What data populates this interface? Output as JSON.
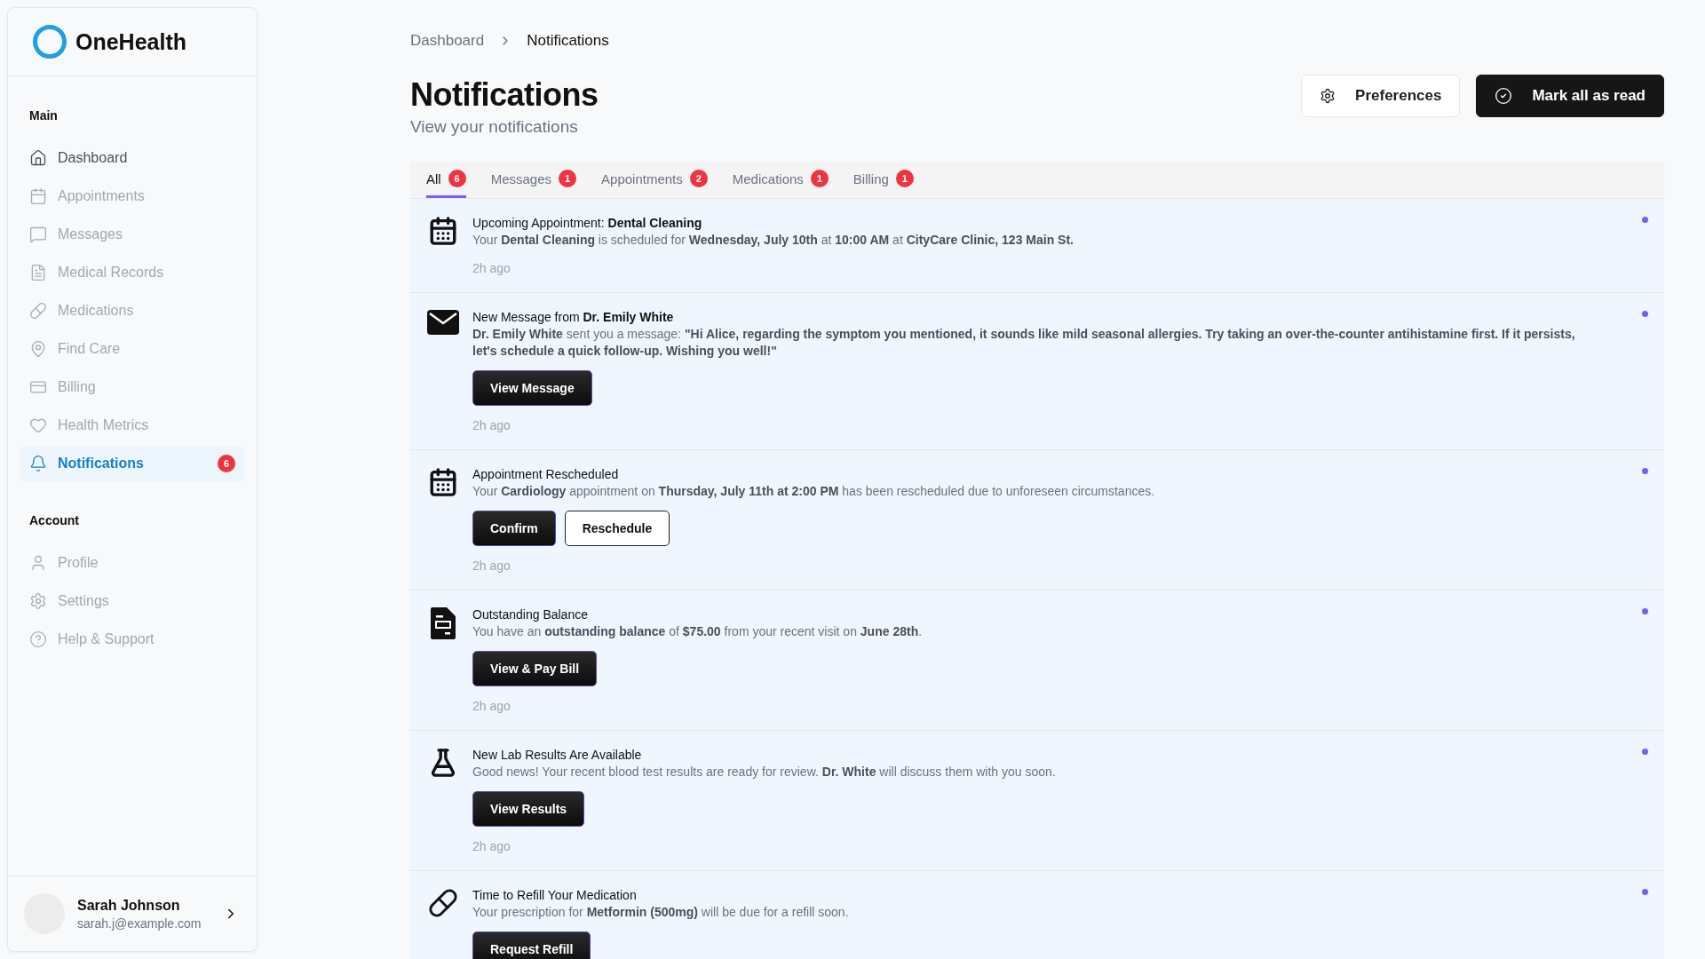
{
  "brand": {
    "name": "OneHealth"
  },
  "sidebar": {
    "sections": [
      {
        "title": "Main",
        "items": [
          {
            "label": "Dashboard",
            "kind": "home",
            "selected": false,
            "disabled": false
          },
          {
            "label": "Appointments",
            "kind": "calendar",
            "selected": false,
            "disabled": true
          },
          {
            "label": "Messages",
            "kind": "message",
            "selected": false,
            "disabled": true
          },
          {
            "label": "Medical Records",
            "kind": "file",
            "selected": false,
            "disabled": true
          },
          {
            "label": "Medications",
            "kind": "pill",
            "selected": false,
            "disabled": true
          },
          {
            "label": "Find Care",
            "kind": "pin",
            "selected": false,
            "disabled": true
          },
          {
            "label": "Billing",
            "kind": "card",
            "selected": false,
            "disabled": true
          },
          {
            "label": "Health Metrics",
            "kind": "heart",
            "selected": false,
            "disabled": true
          },
          {
            "label": "Notifications",
            "kind": "bell",
            "selected": true,
            "disabled": false,
            "badge": "6"
          }
        ]
      },
      {
        "title": "Account",
        "items": [
          {
            "label": "Profile",
            "kind": "user",
            "selected": false,
            "disabled": true
          },
          {
            "label": "Settings",
            "kind": "gear",
            "selected": false,
            "disabled": true
          },
          {
            "label": "Help & Support",
            "kind": "help",
            "selected": false,
            "disabled": true
          }
        ]
      }
    ],
    "user": {
      "name": "Sarah Johnson",
      "email": "sarah.j@example.com"
    }
  },
  "breadcrumb": [
    "Dashboard",
    "Notifications"
  ],
  "header": {
    "title": "Notifications",
    "subtitle": "View your notifications",
    "buttons": [
      {
        "label": "Preferences",
        "kind": "secondary"
      },
      {
        "label": "Mark all as read",
        "kind": "primary"
      }
    ]
  },
  "tabs": [
    {
      "label": "All",
      "count": "6",
      "selected": true
    },
    {
      "label": "Messages",
      "count": "1",
      "selected": false
    },
    {
      "label": "Appointments",
      "count": "2",
      "selected": false
    },
    {
      "label": "Medications",
      "count": "1",
      "selected": false
    },
    {
      "label": "Billing",
      "count": "1",
      "selected": false
    }
  ],
  "notifications": [
    {
      "kind": "appointment",
      "title": "Upcoming Appointment: **Dental Cleaning**",
      "body": "Your **Dental Cleaning** is scheduled for **Wednesday, July 10th** at **10:00 AM** at **CityCare Clinic, 123 Main St.**",
      "time": "2h ago",
      "unread": true
    },
    {
      "kind": "message",
      "title": "New Message from **Dr. Emily White**",
      "body": "**Dr. Emily White** sent you a message: **\"Hi Alice, regarding the symptom you mentioned, it sounds like mild seasonal allergies. Try taking an over-the-counter antihistamine first. If it persists, let's schedule a quick follow-up. Wishing you well!\"**",
      "actions": [
        {
          "label": "View Message",
          "kind": "primary"
        }
      ],
      "time": "2h ago",
      "unread": true
    },
    {
      "kind": "appointment",
      "title": "Appointment Rescheduled",
      "body": "Your **Cardiology** appointment on **Thursday, July 11th at 2:00 PM** has been rescheduled due to unforeseen circumstances.",
      "actions": [
        {
          "label": "Confirm",
          "kind": "primary"
        },
        {
          "label": "Reschedule",
          "kind": "secondary"
        }
      ],
      "time": "2h ago",
      "unread": true
    },
    {
      "kind": "billing",
      "title": "Outstanding Balance",
      "body": "You have an **outstanding balance** of **$75.00** from your recent visit on **June 28th**.",
      "actions": [
        {
          "label": "View & Pay Bill",
          "kind": "primary"
        }
      ],
      "time": "2h ago",
      "unread": true
    },
    {
      "kind": "lab",
      "title": "New Lab Results Are Available",
      "body": "Good news! Your recent blood test results are ready for review. **Dr. White** will discuss them with you soon.",
      "actions": [
        {
          "label": "View Results",
          "kind": "primary"
        }
      ],
      "time": "2h ago",
      "unread": true
    },
    {
      "kind": "medication",
      "title": "Time to Refill Your Medication",
      "body": "Your prescription for **Metformin (500mg)** will be due for a refill soon.",
      "actions": [
        {
          "label": "Request Refill",
          "kind": "primary"
        }
      ],
      "unread": true
    }
  ]
}
